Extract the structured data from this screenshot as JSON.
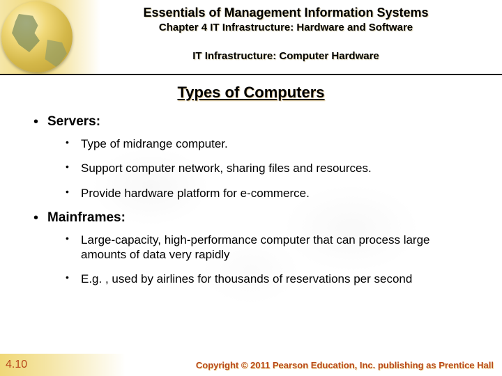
{
  "header": {
    "book_title": "Essentials of Management Information Systems",
    "chapter": "Chapter 4 IT Infrastructure: Hardware and Software",
    "section": "IT Infrastructure: Computer Hardware"
  },
  "topic_title": "Types of Computers",
  "bullets": [
    {
      "heading": "Servers:",
      "items": [
        "Type of midrange computer.",
        "Support computer network, sharing files and resources.",
        "Provide hardware platform for e-commerce."
      ]
    },
    {
      "heading": "Mainframes:",
      "items": [
        "Large-capacity, high-performance computer that can process large amounts of data very rapidly",
        "E.g. , used by airlines for thousands of reservations per second"
      ]
    }
  ],
  "footer": {
    "slide_number": "4.10",
    "copyright": "Copyright © 2011 Pearson Education, Inc. publishing as Prentice Hall"
  }
}
